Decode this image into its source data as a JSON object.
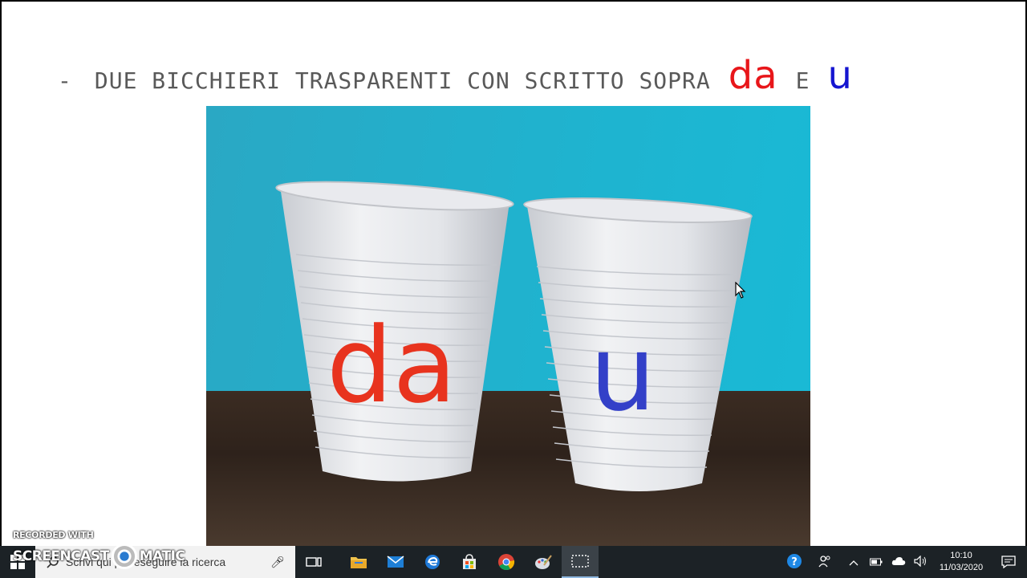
{
  "slide": {
    "dash": "-",
    "text": "DUE BICCHIERI TRASPARENTI CON SCRITTO SOPRA",
    "word_red": "da",
    "connector": "E",
    "word_blue": "u",
    "colors": {
      "text": "#595959",
      "red": "#e8161a",
      "blue": "#1515d0"
    }
  },
  "photo": {
    "cup_left_label": "da",
    "cup_right_label": "u"
  },
  "watermark": {
    "line1": "RECORDED WITH",
    "line2a": "SCREENCAST",
    "line2b": "MATIC"
  },
  "taskbar": {
    "search_placeholder": "Scrivi qui per eseguire la ricerca",
    "pinned_icons": [
      "task-view-icon",
      "file-explorer-icon",
      "mail-icon",
      "edge-icon",
      "store-icon",
      "chrome-icon",
      "paint-icon",
      "screen-recorder-icon"
    ],
    "time": "10:10",
    "date": "11/03/2020"
  }
}
